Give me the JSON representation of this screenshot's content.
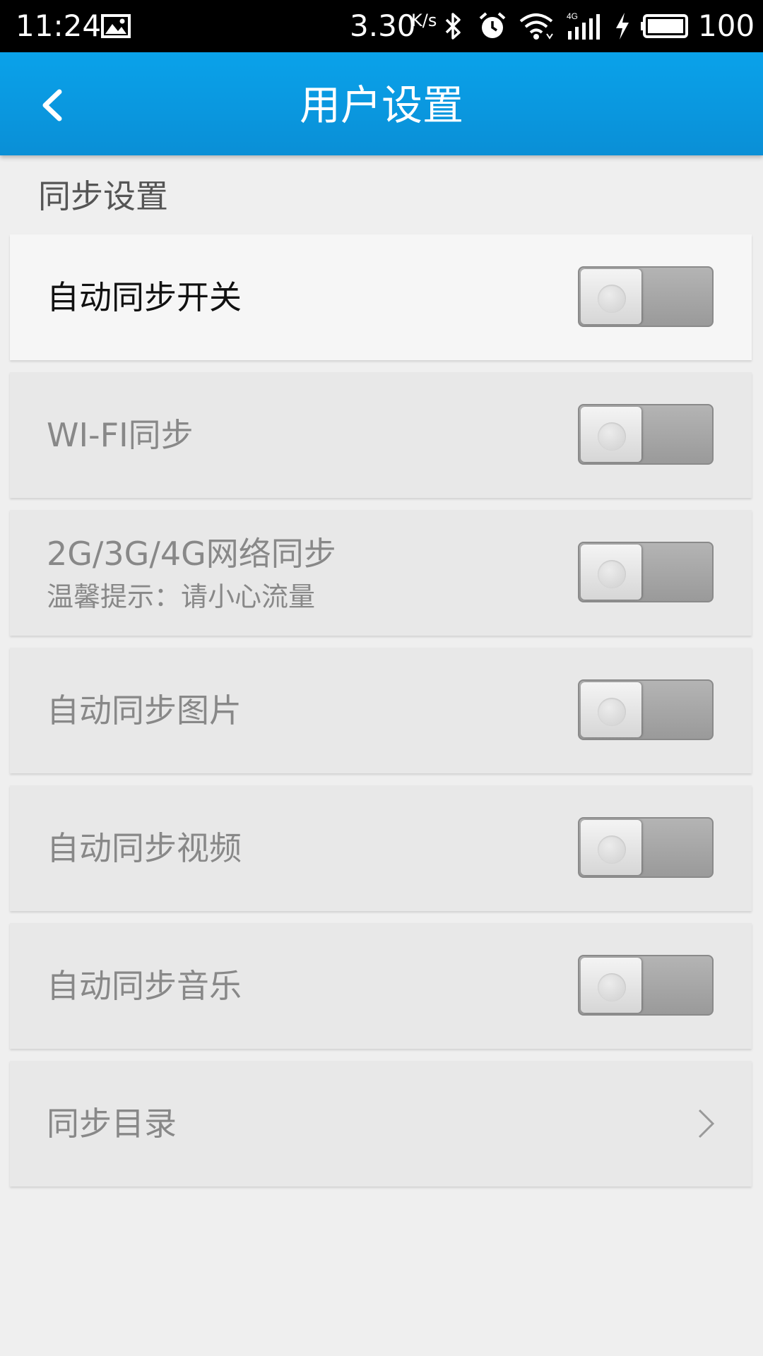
{
  "status_bar": {
    "time": "11:24",
    "speed": "3.30",
    "speed_unit": "K/s",
    "network": "4G",
    "battery": "100",
    "icons": [
      "image-icon",
      "bluetooth-icon",
      "alarm-icon",
      "wifi-icon",
      "signal-icon",
      "charging-icon",
      "battery-icon"
    ]
  },
  "header": {
    "title": "用户设置"
  },
  "section": {
    "title": "同步设置"
  },
  "settings": [
    {
      "label": "自动同步开关",
      "toggle_on": false
    },
    {
      "label": "WI-FI同步",
      "toggle_on": false
    },
    {
      "label": "2G/3G/4G网络同步",
      "sublabel": "温馨提示：请小心流量",
      "toggle_on": false
    },
    {
      "label": "自动同步图片",
      "toggle_on": false
    },
    {
      "label": "自动同步视频",
      "toggle_on": false
    },
    {
      "label": "自动同步音乐",
      "toggle_on": false
    }
  ],
  "nav_item": {
    "label": "同步目录"
  },
  "colors": {
    "header": "#0a9ae2",
    "background": "#efefef",
    "card": "#e8e8e8"
  }
}
